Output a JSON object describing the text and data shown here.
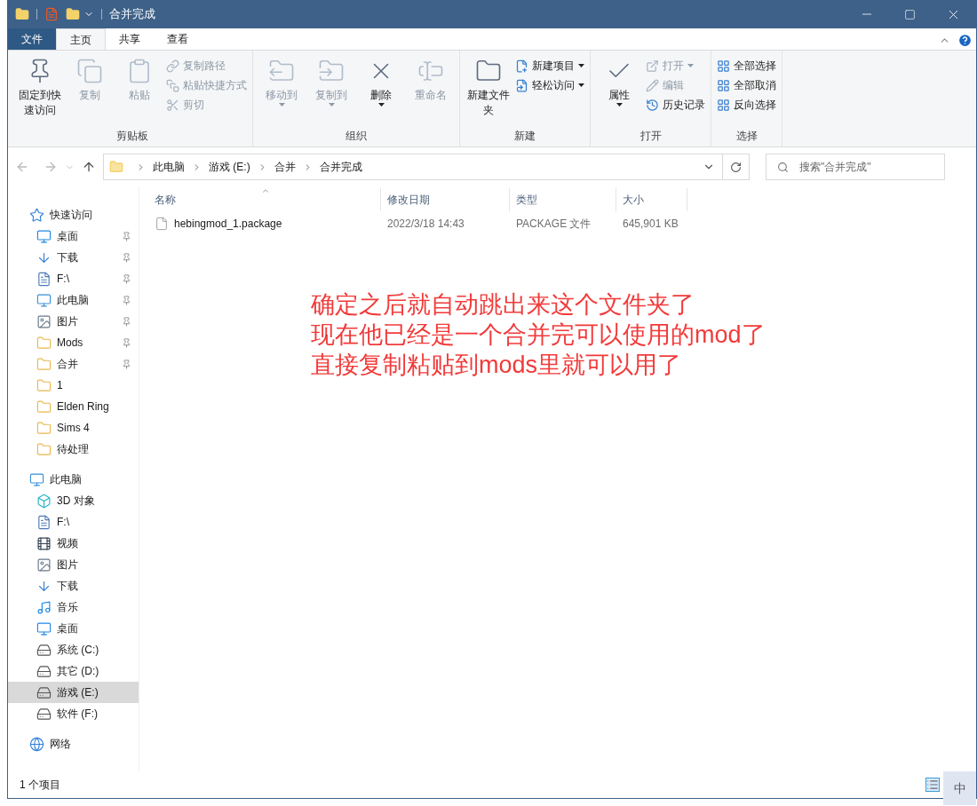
{
  "window": {
    "title": "合并完成"
  },
  "ribbon_tabs": [
    {
      "label": "文件",
      "kind": "file",
      "selected": false
    },
    {
      "label": "主页",
      "kind": "tab",
      "selected": true
    },
    {
      "label": "共享",
      "kind": "tab",
      "selected": false
    },
    {
      "label": "查看",
      "kind": "tab",
      "selected": false
    }
  ],
  "ribbon": {
    "groups": [
      {
        "label": "剪贴板",
        "items": [
          {
            "kind": "large",
            "label": "固定到快速访问",
            "disabled": false,
            "dropdown": false
          },
          {
            "kind": "large",
            "label": "复制",
            "disabled": true,
            "dropdown": false
          },
          {
            "kind": "large",
            "label": "粘贴",
            "disabled": true,
            "dropdown": false
          },
          {
            "kind": "small",
            "label": "复制路径",
            "disabled": true,
            "dropdown": false
          },
          {
            "kind": "small",
            "label": "粘贴快捷方式",
            "disabled": true,
            "dropdown": false
          },
          {
            "kind": "small",
            "label": "剪切",
            "disabled": true,
            "dropdown": false
          }
        ]
      },
      {
        "label": "组织",
        "items": [
          {
            "kind": "large",
            "label": "移动到",
            "disabled": true,
            "dropdown": true
          },
          {
            "kind": "large",
            "label": "复制到",
            "disabled": true,
            "dropdown": true
          },
          {
            "kind": "large",
            "label": "删除",
            "disabled": false,
            "dropdown": true
          },
          {
            "kind": "large",
            "label": "重命名",
            "disabled": true,
            "dropdown": false
          }
        ]
      },
      {
        "label": "新建",
        "items": [
          {
            "kind": "large",
            "label": "新建文件夹",
            "disabled": false,
            "dropdown": false
          },
          {
            "kind": "small",
            "label": "新建项目",
            "disabled": false,
            "dropdown": true
          },
          {
            "kind": "small",
            "label": "轻松访问",
            "disabled": false,
            "dropdown": true
          }
        ]
      },
      {
        "label": "打开",
        "items": [
          {
            "kind": "large",
            "label": "属性",
            "disabled": false,
            "dropdown": true
          },
          {
            "kind": "small",
            "label": "打开",
            "disabled": true,
            "dropdown": true
          },
          {
            "kind": "small",
            "label": "编辑",
            "disabled": true,
            "dropdown": false
          },
          {
            "kind": "small",
            "label": "历史记录",
            "disabled": false,
            "dropdown": false
          }
        ]
      },
      {
        "label": "选择",
        "items": [
          {
            "kind": "small",
            "label": "全部选择",
            "disabled": false,
            "dropdown": false
          },
          {
            "kind": "small",
            "label": "全部取消",
            "disabled": false,
            "dropdown": false
          },
          {
            "kind": "small",
            "label": "反向选择",
            "disabled": false,
            "dropdown": false
          }
        ]
      }
    ]
  },
  "address_bar": {
    "path": [
      "此电脑",
      "游戏 (E:)",
      "合并",
      "合并完成"
    ]
  },
  "search": {
    "placeholder": "搜索\"合并完成\""
  },
  "sidebar": {
    "items": [
      {
        "label": "快速访问",
        "kind": "quick",
        "selected": false,
        "children": [
          {
            "label": "桌面",
            "kind": "desktop",
            "pinned": true,
            "selected": false
          },
          {
            "label": "下载",
            "kind": "download",
            "pinned": true,
            "selected": false
          },
          {
            "label": "F:\\",
            "kind": "doc",
            "pinned": true,
            "selected": false
          },
          {
            "label": "此电脑",
            "kind": "pc",
            "pinned": true,
            "selected": false
          },
          {
            "label": "图片",
            "kind": "picture",
            "pinned": true,
            "selected": false
          },
          {
            "label": "Mods",
            "kind": "folder",
            "pinned": true,
            "selected": false
          },
          {
            "label": "合并",
            "kind": "folder",
            "pinned": true,
            "selected": false
          },
          {
            "label": "1",
            "kind": "folder",
            "pinned": false,
            "selected": false
          },
          {
            "label": "Elden Ring",
            "kind": "folder",
            "pinned": false,
            "selected": false
          },
          {
            "label": "Sims 4",
            "kind": "folder",
            "pinned": false,
            "selected": false
          },
          {
            "label": "待处理",
            "kind": "folder",
            "pinned": false,
            "selected": false
          }
        ]
      },
      {
        "label": "此电脑",
        "kind": "pc",
        "selected": false,
        "children": [
          {
            "label": "3D 对象",
            "kind": "cube",
            "pinned": false,
            "selected": false
          },
          {
            "label": "F:\\",
            "kind": "doc",
            "pinned": false,
            "selected": false
          },
          {
            "label": "视频",
            "kind": "video",
            "pinned": false,
            "selected": false
          },
          {
            "label": "图片",
            "kind": "picture",
            "pinned": false,
            "selected": false
          },
          {
            "label": "下载",
            "kind": "download",
            "pinned": false,
            "selected": false
          },
          {
            "label": "音乐",
            "kind": "music",
            "pinned": false,
            "selected": false
          },
          {
            "label": "桌面",
            "kind": "desktop",
            "pinned": false,
            "selected": false
          },
          {
            "label": "系统 (C:)",
            "kind": "drive",
            "pinned": false,
            "selected": false
          },
          {
            "label": "其它 (D:)",
            "kind": "drive",
            "pinned": false,
            "selected": false
          },
          {
            "label": "游戏 (E:)",
            "kind": "drive",
            "pinned": false,
            "selected": true
          },
          {
            "label": "软件 (F:)",
            "kind": "drive",
            "pinned": false,
            "selected": false
          }
        ]
      },
      {
        "label": "网络",
        "kind": "network",
        "selected": false
      }
    ]
  },
  "file_list": {
    "columns": [
      "名称",
      "修改日期",
      "类型",
      "大小"
    ],
    "rows": [
      {
        "name": "hebingmod_1.package",
        "modified": "2022/3/18 14:43",
        "type": "PACKAGE 文件",
        "size": "645,901 KB",
        "selected": false
      }
    ]
  },
  "annotation": {
    "lines": [
      "确定之后就自动跳出来这个文件夹了",
      "现在他已经是一个合并完可以使用的mod了",
      "直接复制粘贴到mods里就可以用了"
    ]
  },
  "status_bar": {
    "item_count": "1 个项目"
  },
  "ime_indicator": "中"
}
